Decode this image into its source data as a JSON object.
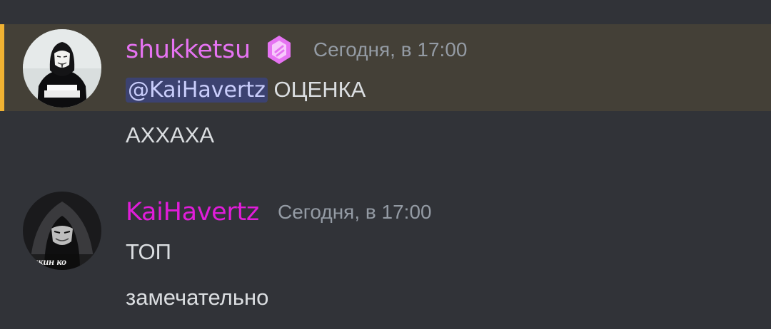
{
  "messages": [
    {
      "username": "shukketsu",
      "username_color": "#e673f2",
      "badge_icon": "gem-badge-icon",
      "timestamp": "Сегодня, в 17:00",
      "highlighted": true,
      "highlight_bar_color": "#f0b232",
      "mention": "@KaiHavertz",
      "mention_text": " ОЦЕНКА",
      "followup": "АХХАХА"
    },
    {
      "username": "KaiHavertz",
      "username_color": "#e01dd9",
      "timestamp": "Сегодня, в 17:00",
      "line1": "ТОП",
      "line2": "замечательно",
      "avatar_caption": "чкин ко"
    }
  ]
}
